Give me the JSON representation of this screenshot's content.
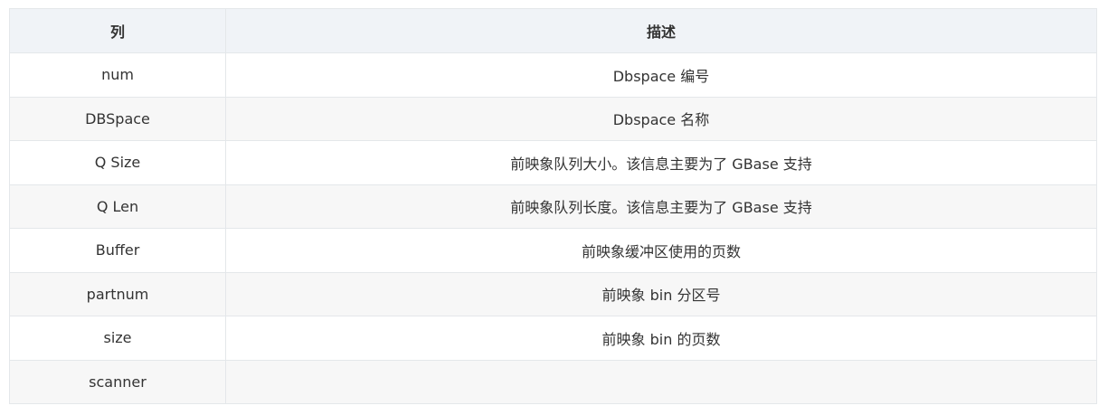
{
  "table": {
    "headers": [
      "列",
      "描述"
    ],
    "rows": [
      {
        "column": "num",
        "description": "Dbspace 编号"
      },
      {
        "column": "DBSpace",
        "description": "Dbspace 名称"
      },
      {
        "column": "Q Size",
        "description": "前映象队列大小。该信息主要为了 GBase 支持"
      },
      {
        "column": "Q Len",
        "description": "前映象队列长度。该信息主要为了 GBase 支持"
      },
      {
        "column": "Buffer",
        "description": "前映象缓冲区使用的页数"
      },
      {
        "column": "partnum",
        "description": "前映象 bin 分区号"
      },
      {
        "column": "size",
        "description": "前映象 bin 的页数"
      },
      {
        "column": "scanner",
        "description": ""
      }
    ]
  },
  "colors": {
    "header_bg": "#f0f3f7",
    "row_alt_bg": "#f7f7f7",
    "border": "#e4e7ea",
    "text": "#333333"
  }
}
